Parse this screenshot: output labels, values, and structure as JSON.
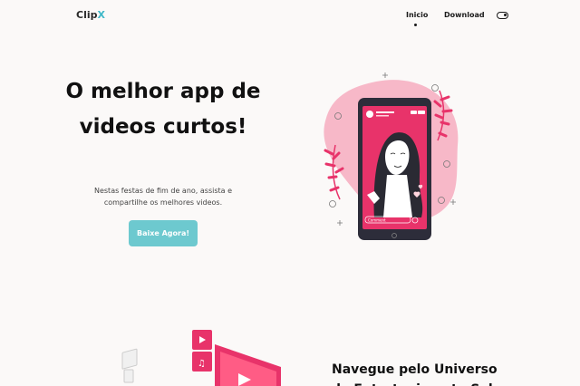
{
  "nav": {
    "logo_main": "Clip",
    "logo_accent": "X",
    "links": [
      "Inicio",
      "Download"
    ],
    "active_link": "Inicio",
    "theme_toggle_icon": "toggle-icon"
  },
  "hero": {
    "title": "O melhor app de videos curtos!",
    "subtitle": "Nestas festas de fim de ano, assista e compartilhe os melhores videos.",
    "cta_label": "Baixe Agora!",
    "cta_color": "#6dc9cf",
    "illustration_icon": "phone-illustration",
    "phone_comment_placeholder": "Comment"
  },
  "section2": {
    "title": "Navegue pelo Universo de Entretenimento Sob"
  },
  "colors": {
    "accent": "#3fb8c8",
    "pink": "#e8336a",
    "blob": "#f7b8c8"
  }
}
